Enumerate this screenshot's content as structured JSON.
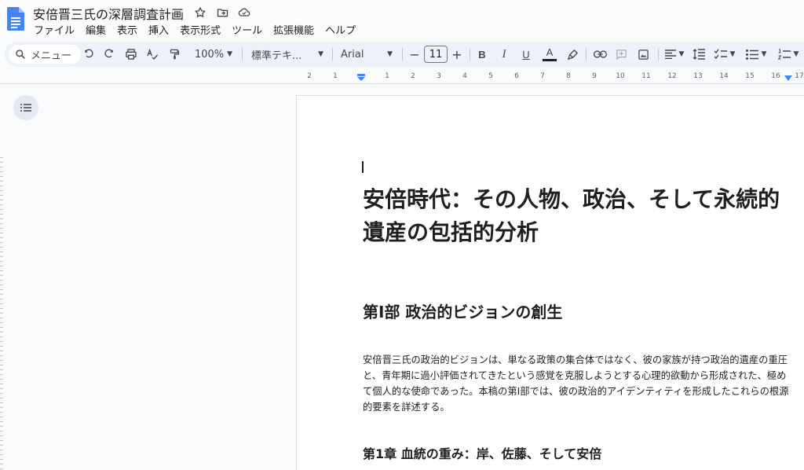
{
  "app": {
    "title": "安倍晋三氏の深層調査計画"
  },
  "menu": {
    "items": [
      "ファイル",
      "編集",
      "表示",
      "挿入",
      "表示形式",
      "ツール",
      "拡張機能",
      "ヘルプ"
    ]
  },
  "toolbar": {
    "search_label": "メニュー",
    "zoom": "100%",
    "style": "標準テキ...",
    "font": "Arial",
    "font_size": "11",
    "minus": "−",
    "plus": "+",
    "bold": "B",
    "italic": "I",
    "underline": "U",
    "text_color": "A",
    "accent_color": "#1f1f1f"
  },
  "ruler": {
    "labels": [
      "2",
      "1",
      "1",
      "2",
      "3",
      "4",
      "5",
      "6",
      "7",
      "8",
      "9",
      "10",
      "11",
      "12",
      "13",
      "14",
      "15",
      "16",
      "17"
    ]
  },
  "document": {
    "title": "安倍時代：その人物、政治、そして永続的遺産の包括的分析",
    "part_heading": "第Ⅰ部 政治的ビジョンの創生",
    "paragraph": "安倍晋三氏の政治的ビジョンは、単なる政策の集合体ではなく、彼の家族が持つ政治的遺産の重圧と、青年期に過小評価されてきたという感覚を克服しようとする心理的欲動から形成された、極めて個人的な使命であった。本稿の第Ⅰ部では、彼の政治的アイデンティティを形成したこれらの根源的要素を詳述する。",
    "chapter_heading": "第1章 血統の重み：岸、佐藤、そして安倍"
  },
  "colors": {
    "docs_blue": "#4285f4",
    "toolbar_bg": "#edf2fa",
    "page_bg": "#ffffff",
    "marker_blue": "#4285f4"
  }
}
